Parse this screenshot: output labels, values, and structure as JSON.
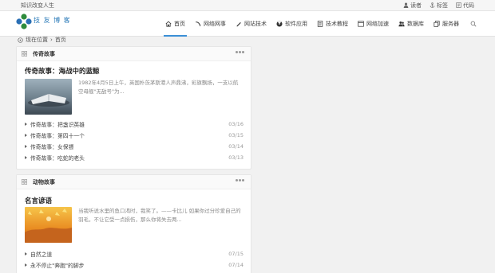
{
  "topbar": {
    "motto": "知识改变人生",
    "links": [
      {
        "label": "读者",
        "icon": "person-icon"
      },
      {
        "label": "标签",
        "icon": "anchor-icon"
      },
      {
        "label": "代码",
        "icon": "code-icon"
      }
    ]
  },
  "logo": {
    "text": "技 友 博 客"
  },
  "nav": {
    "items": [
      {
        "label": "首页",
        "icon": "home-icon",
        "active": true
      },
      {
        "label": "网络网事",
        "icon": "leaf-icon"
      },
      {
        "label": "网站技术",
        "icon": "pen-icon"
      },
      {
        "label": "软件应用",
        "icon": "radiation-icon"
      },
      {
        "label": "技术教程",
        "icon": "document-icon"
      },
      {
        "label": "网络加速",
        "icon": "window-icon"
      },
      {
        "label": "数据库",
        "icon": "people-icon"
      },
      {
        "label": "服务器",
        "icon": "copy-icon"
      }
    ],
    "search_icon": "search-icon"
  },
  "breadcrumb": {
    "prefix": "现在位置",
    "sep": "›",
    "current": "首页"
  },
  "sections": [
    {
      "title": "传奇故事",
      "featured": {
        "title": "传奇故事：海战中的蓝鲸",
        "excerpt": "1982年4月5日上午，英国朴茨茅斯港人声鼎沸，彩旗飘扬，一支以航空母舰\"无敌号\"为..."
      },
      "posts": [
        {
          "title": "传奇故事：把盏识英雄",
          "date": "03/16"
        },
        {
          "title": "传奇故事：第四十一个",
          "date": "03/15"
        },
        {
          "title": "传奇故事：女保镖",
          "date": "03/14"
        },
        {
          "title": "传奇故事：吃蛇的老头",
          "date": "03/13"
        }
      ]
    },
    {
      "title": "动物故事",
      "featured": {
        "title": "名言谚语",
        "excerpt": "当我听说水里的鱼口渴时，我笑了。——卡比儿 如果你过分珍爱自己的羽毛，不让它受一点损伤，那么你将失去两..."
      },
      "posts": [
        {
          "title": "自然之道",
          "date": "07/15"
        },
        {
          "title": "永不停止\"奔跑\"的脚步",
          "date": "07/14"
        }
      ]
    }
  ],
  "colors": {
    "accent": "#3b8fd6",
    "logo": "#2a7ab8"
  }
}
